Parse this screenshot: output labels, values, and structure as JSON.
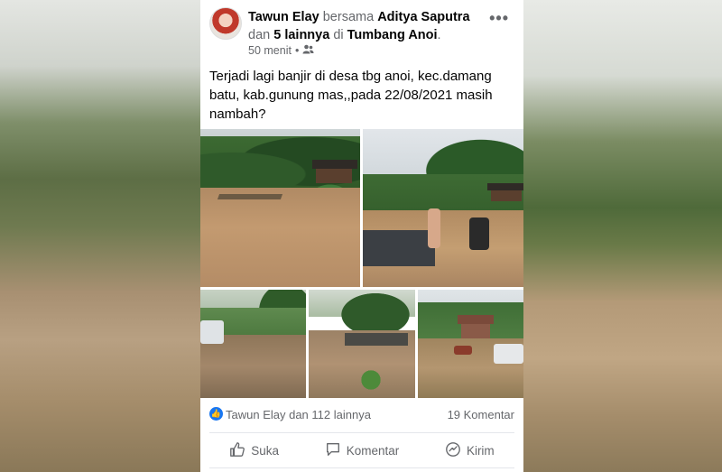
{
  "post": {
    "author": "Tawun Elay",
    "with_word": "bersama",
    "tagged": "Aditya Saputra",
    "and_word": "dan",
    "others": "5 lainnya",
    "at_word": "di",
    "location": "Tumbang Anoi",
    "location_period": ".",
    "time": "50 menit",
    "separator": "•",
    "audience_icon": "friends-icon",
    "more_label": "•••",
    "text": "Terjadi lagi banjir di desa tbg anoi, kec.damang batu, kab.gunung mas,,pada 22/08/2021 masih nambah?"
  },
  "stats": {
    "reactors": "Tawun Elay dan 112 lainnya",
    "comments": "19 Komentar"
  },
  "actions": {
    "like": "Suka",
    "comment": "Komentar",
    "share": "Kirim"
  },
  "colors": {
    "accent": "#1877f2",
    "text": "#050505",
    "muted": "#65676b"
  }
}
